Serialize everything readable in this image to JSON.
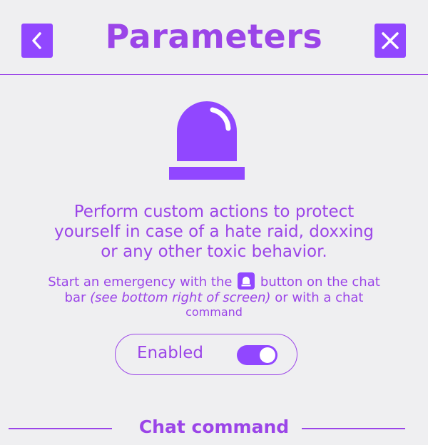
{
  "header": {
    "title": "Parameters",
    "back_icon": "chevron-left-icon",
    "close_icon": "close-icon"
  },
  "hero": {
    "icon": "siren-icon"
  },
  "description": {
    "line1": "Perform custom actions to protect",
    "line2": "yourself in case of a hate raid, doxxing",
    "line3": "or any other toxic behavior."
  },
  "hint": {
    "part1": "Start an emergency with the",
    "icon": "siren-icon",
    "part2": "button on the chat",
    "part3": "bar",
    "italic": "(see bottom right of screen)",
    "part4": "or with a chat",
    "part5": "command"
  },
  "toggle": {
    "label": "Enabled",
    "state": "on"
  },
  "section": {
    "title": "Chat command"
  },
  "colors": {
    "accent": "#9147ff",
    "text": "#9b45e8",
    "background": "#efeff1"
  }
}
